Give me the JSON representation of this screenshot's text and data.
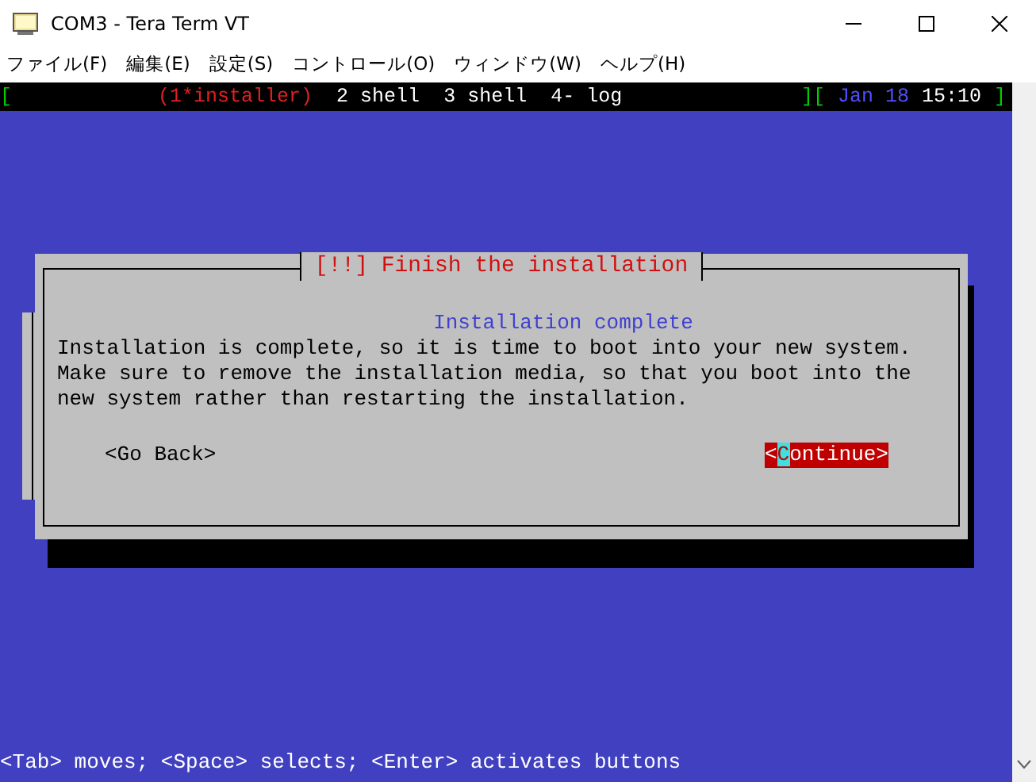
{
  "window": {
    "title": "COM3 - Tera Term VT"
  },
  "menu": [
    "ファイル(F)",
    "編集(E)",
    "設定(S)",
    "コントロール(O)",
    "ウィンドウ(W)",
    "ヘルプ(H)"
  ],
  "status_line": {
    "brackets": [
      "[",
      "][",
      "]"
    ],
    "windows": [
      {
        "label": "(1*installer)",
        "selected": true
      },
      {
        "label": "2 shell",
        "selected": false
      },
      {
        "label": "3 shell",
        "selected": false
      },
      {
        "label": "4- log",
        "selected": false
      }
    ],
    "date": "Jan 18",
    "time": "15:10"
  },
  "dialog": {
    "title": "[!!] Finish the installation",
    "heading": "Installation complete",
    "message_lines": [
      "Installation is complete, so it is time to boot into your new system.",
      "Make sure to remove the installation media, so that you boot into the",
      "new system rather than restarting the installation."
    ],
    "buttons": [
      {
        "label": "<Go Back>",
        "selected": false
      },
      {
        "label": "<Continue>",
        "selected": true
      }
    ]
  },
  "help_line": "<Tab> moves; <Space> selects; <Enter> activates buttons"
}
